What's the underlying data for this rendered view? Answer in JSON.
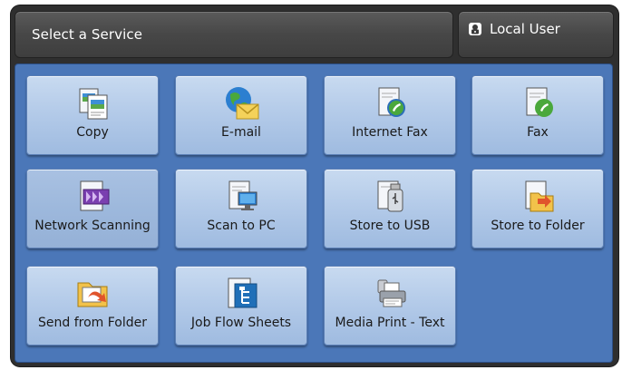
{
  "header": {
    "title": "Select a Service",
    "user_label": "Local User"
  },
  "services": [
    {
      "label": "Copy",
      "icon": "copy-icon"
    },
    {
      "label": "E-mail",
      "icon": "email-icon"
    },
    {
      "label": "Internet Fax",
      "icon": "internet-fax-icon"
    },
    {
      "label": "Fax",
      "icon": "fax-icon"
    },
    {
      "label": "Network Scanning",
      "icon": "network-scanning-icon"
    },
    {
      "label": "Scan to PC",
      "icon": "scan-to-pc-icon"
    },
    {
      "label": "Store to USB",
      "icon": "store-to-usb-icon"
    },
    {
      "label": "Store to Folder",
      "icon": "store-to-folder-icon"
    },
    {
      "label": "Send from Folder",
      "icon": "send-from-folder-icon"
    },
    {
      "label": "Job Flow Sheets",
      "icon": "job-flow-sheets-icon"
    },
    {
      "label": "Media Print - Text",
      "icon": "media-print-icon"
    }
  ],
  "colors": {
    "panel": "#4b77b8",
    "tile": "#b4cbe9",
    "header": "#474747"
  }
}
